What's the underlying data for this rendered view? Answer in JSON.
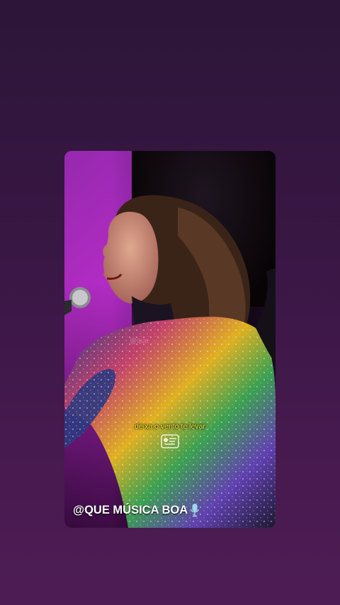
{
  "video": {
    "subtitle": "deixa o vento te levar",
    "watermark_text": "@que",
    "handle": "@QUE MÚSICA BOA",
    "icons": {
      "mic": "microphone-icon",
      "logo": "channel-logo-icon"
    }
  },
  "colors": {
    "background_top": "#2c1538",
    "background_bottom": "#4e1c55",
    "subtitle": "#f3ee3a",
    "handle": "#ffffff",
    "stage_light": "#b52ec8"
  }
}
